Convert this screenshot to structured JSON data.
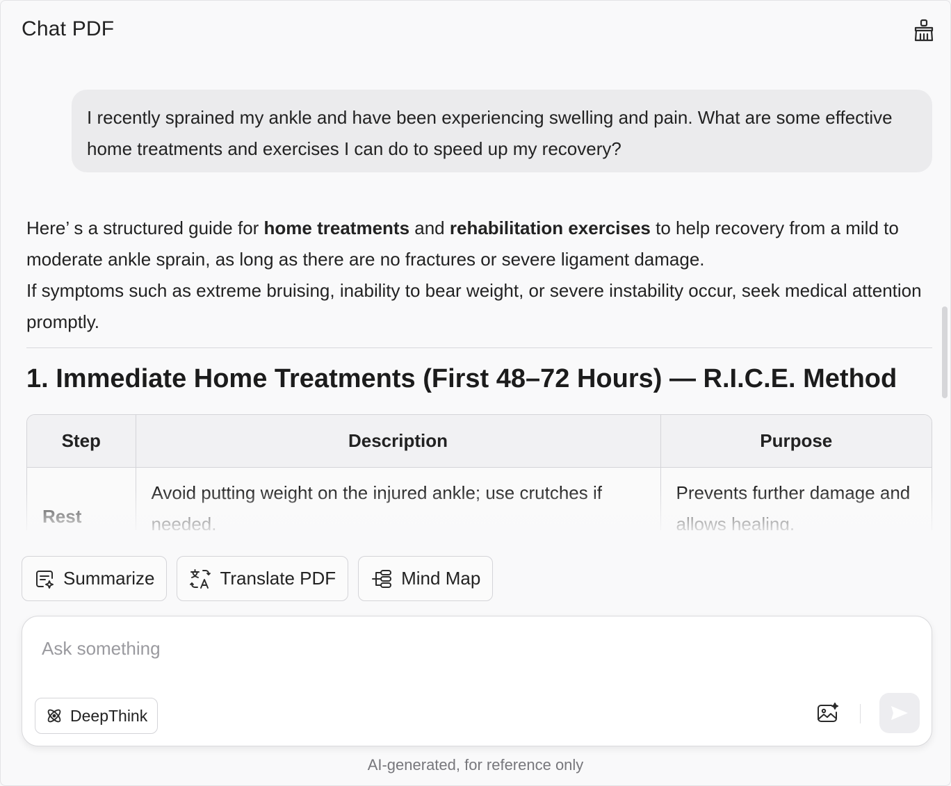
{
  "app": {
    "title": "Chat PDF"
  },
  "conversation": {
    "user_message": "I recently sprained my ankle and have been experiencing swelling and pain. What are some effective home treatments and exercises I can do to speed up my recovery?",
    "answer": {
      "intro_part1": "Here’ s a structured guide for ",
      "intro_bold1": "home treatments",
      "intro_part2": " and ",
      "intro_bold2": "rehabilitation exercises",
      "intro_part3": " to help recovery from a mild to moderate ankle sprain, as long as there are no fractures or severe ligament damage.",
      "warning": "If symptoms such as extreme bruising, inability to bear weight, or severe instability occur, seek medical attention promptly.",
      "section_title": "1. Immediate Home Treatments (First 48–72 Hours) — R.I.C.E. Method",
      "table": {
        "headers": [
          "Step",
          "Description",
          "Purpose"
        ],
        "rows": [
          {
            "step": "Rest",
            "description": "Avoid putting weight on the injured ankle; use crutches if needed.",
            "purpose": "Prevents further damage and allows healing."
          }
        ]
      }
    }
  },
  "actions": [
    {
      "label": "Summarize",
      "icon": "summarize-icon"
    },
    {
      "label": "Translate PDF",
      "icon": "translate-icon"
    },
    {
      "label": "Mind Map",
      "icon": "mind-map-icon"
    }
  ],
  "composer": {
    "placeholder": "Ask something",
    "deepthink_label": "DeepThink"
  },
  "footer": {
    "disclaimer": "AI-generated, for reference only"
  }
}
